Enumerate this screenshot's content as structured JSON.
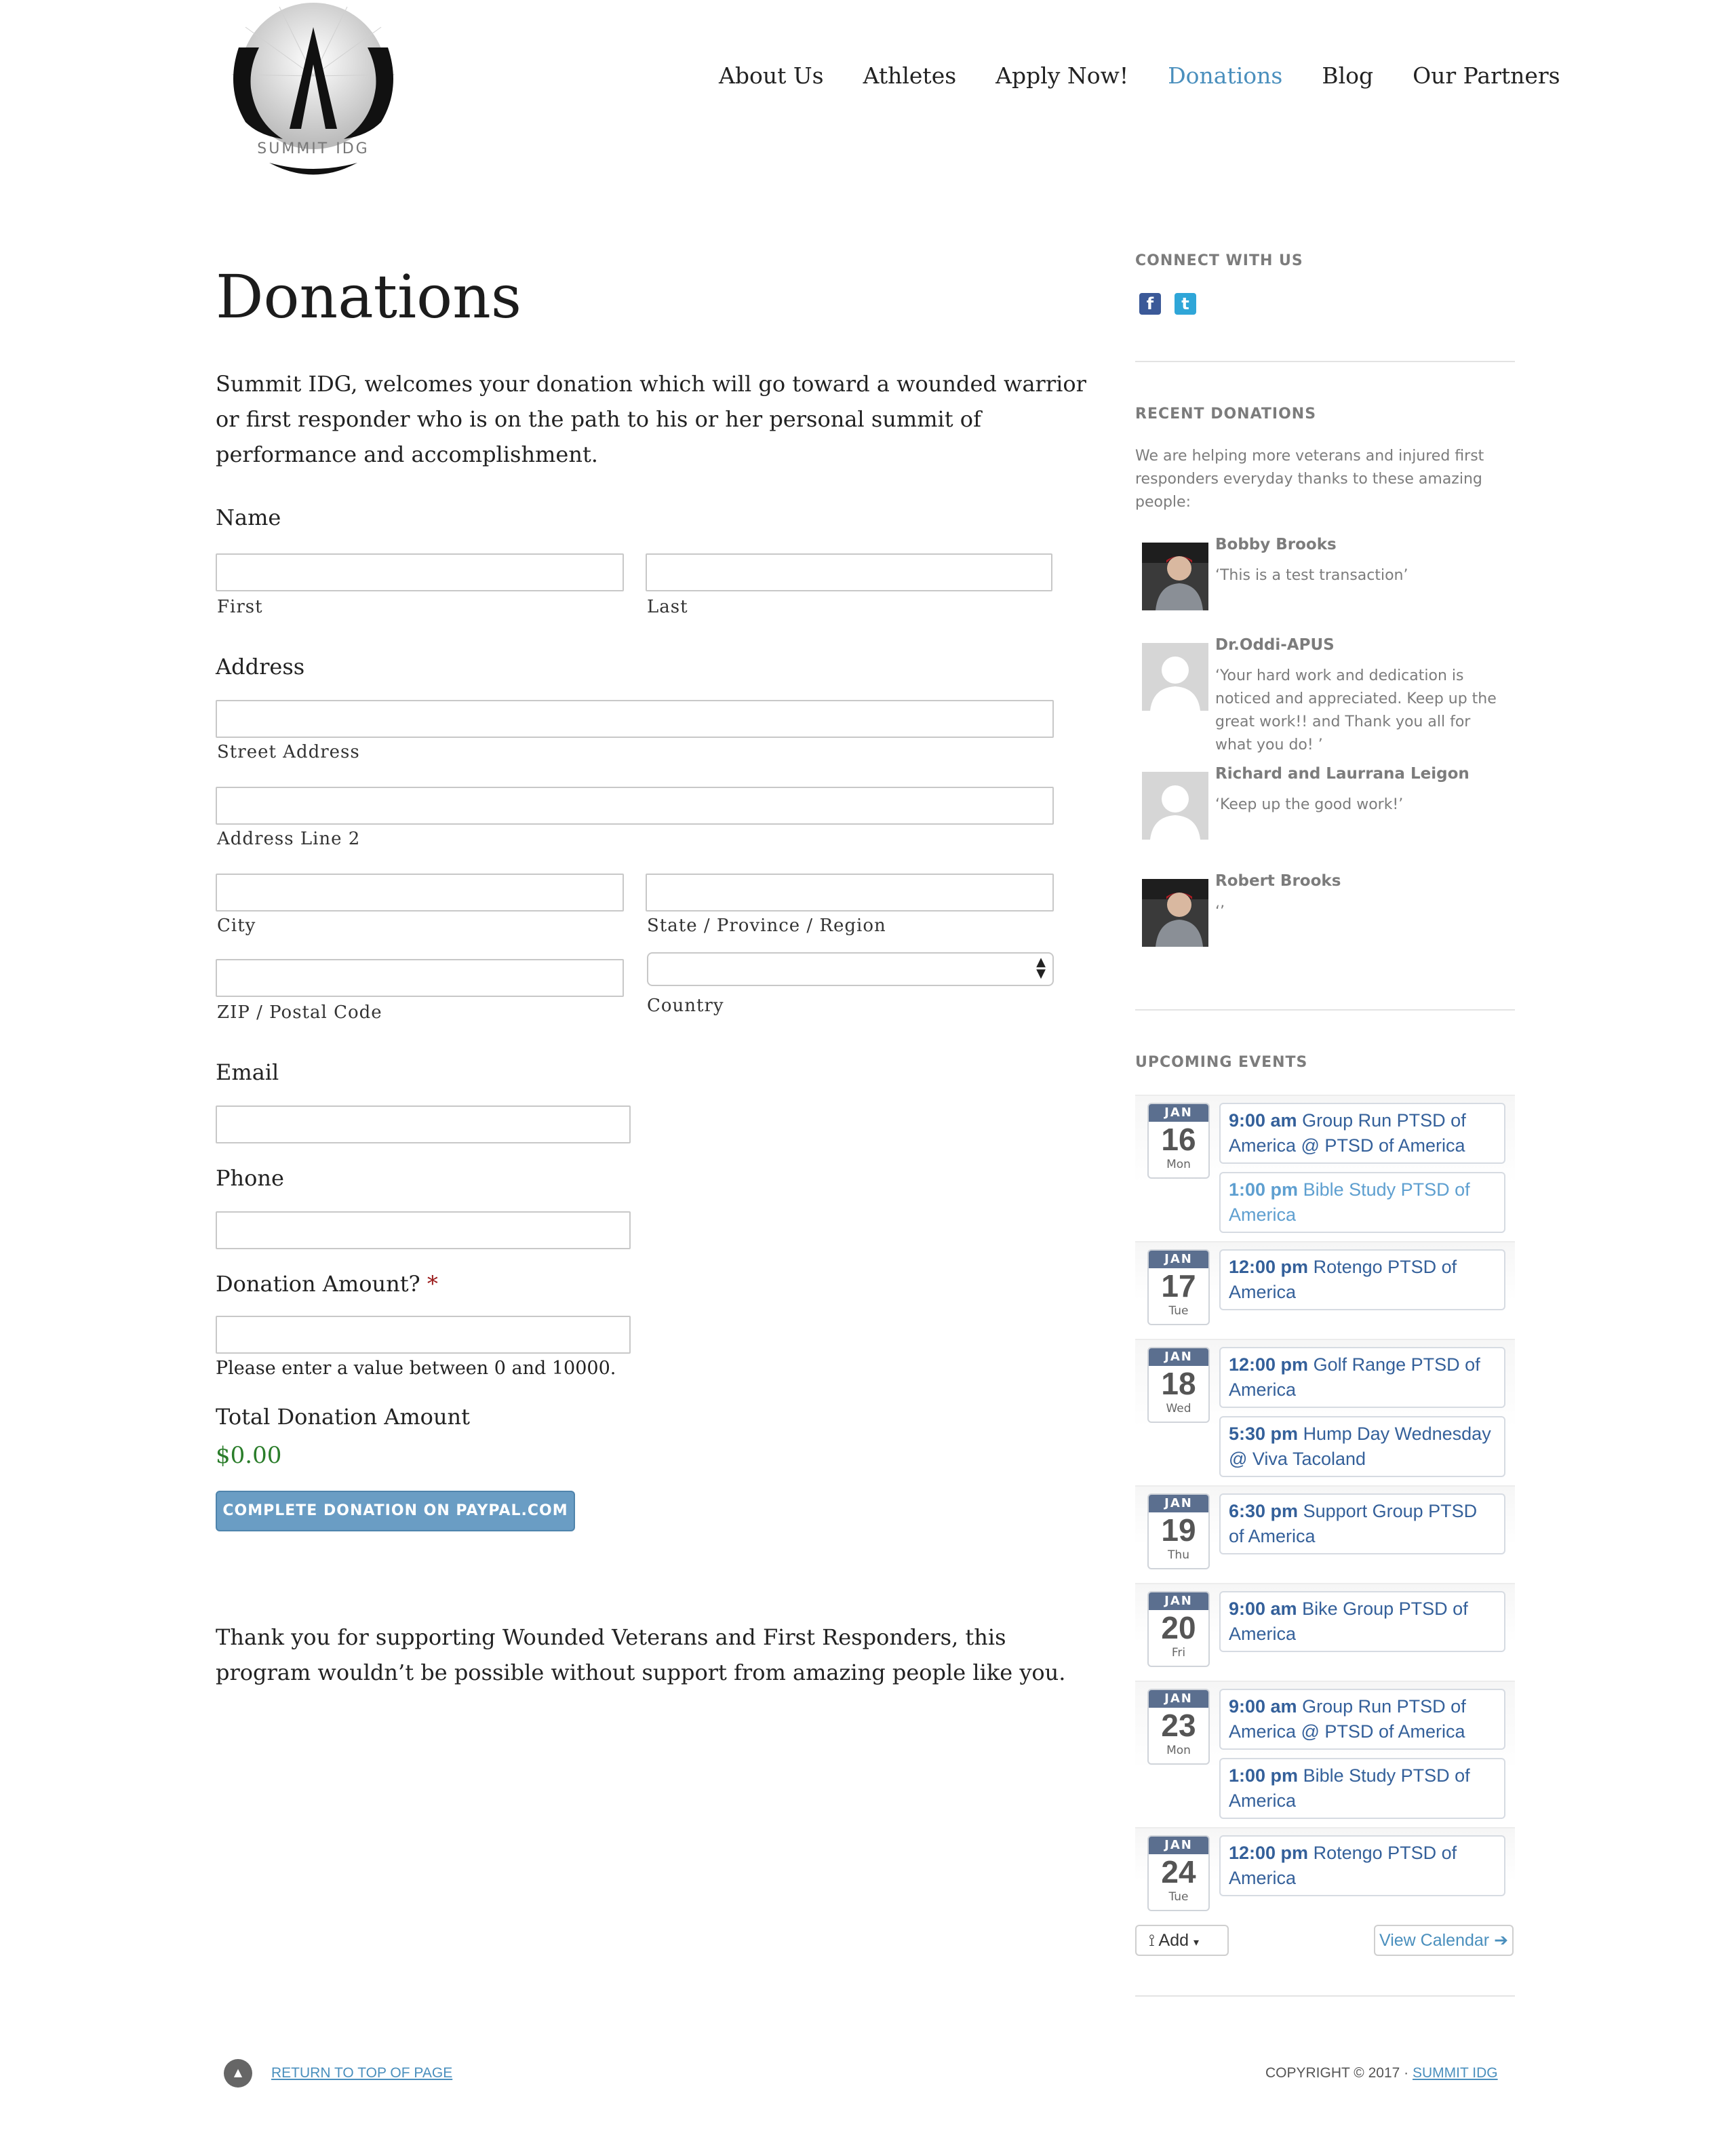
{
  "header": {
    "logo_text": "SUMMIT IDG",
    "nav": [
      {
        "label": "About Us",
        "active": false
      },
      {
        "label": "Athletes",
        "active": false
      },
      {
        "label": "Apply Now!",
        "active": false
      },
      {
        "label": "Donations",
        "active": true
      },
      {
        "label": "Blog",
        "active": false
      },
      {
        "label": "Our Partners",
        "active": false
      }
    ]
  },
  "main": {
    "title": "Donations",
    "intro": "Summit IDG, welcomes your donation which will go toward a wounded warrior or first responder who is on the path to his or her personal summit of performance and accomplishment.",
    "form": {
      "name_label": "Name",
      "first_label": "First",
      "last_label": "Last",
      "address_label": "Address",
      "street_label": "Street Address",
      "line2_label": "Address Line 2",
      "city_label": "City",
      "state_label": "State / Province / Region",
      "zip_label": "ZIP / Postal Code",
      "country_label": "Country",
      "email_label": "Email",
      "phone_label": "Phone",
      "amount_label": "Donation Amount?",
      "required_mark": "*",
      "amount_hint": "Please enter a value between 0 and 10000.",
      "total_label": "Total Donation Amount",
      "total_value": "$0.00",
      "submit_label": "COMPLETE DONATION ON PAYPAL.COM"
    },
    "thanks": "Thank you for supporting Wounded Veterans and First Responders, this program wouldn’t be possible without support from amazing people like you."
  },
  "sidebar": {
    "connect_title": "CONNECT WITH US",
    "social": [
      {
        "icon": "facebook-icon",
        "glyph": "f",
        "color": "#3b5998"
      },
      {
        "icon": "twitter-icon",
        "glyph": "t",
        "color": "#2fa6d8"
      }
    ],
    "recent_title": "RECENT DONATIONS",
    "recent_intro": "We are helping more veterans and injured first responders everyday thanks to these amazing people:",
    "donors": [
      {
        "name": "Bobby Brooks",
        "message": "‘This is a test transaction’",
        "avatar": "photo"
      },
      {
        "name": "Dr.Oddi-APUS",
        "message": "‘Your hard work and dedication is noticed and appreciated. Keep up the great work!! and Thank you all for what you do! ’",
        "avatar": "placeholder"
      },
      {
        "name": "Richard and Laurrana Leigon",
        "message": "‘Keep up the good work!’",
        "avatar": "placeholder"
      },
      {
        "name": "Robert Brooks",
        "message": "‘’",
        "avatar": "photo"
      }
    ],
    "events_title": "UPCOMING EVENTS",
    "event_days": [
      {
        "month": "JAN",
        "day": "16",
        "weekday": "Mon",
        "events": [
          {
            "time": "9:00 am",
            "title": "Group Run PTSD of America @ PTSD of America",
            "style": "dark"
          },
          {
            "time": "1:00 pm",
            "title": "Bible Study PTSD of America",
            "style": "light"
          }
        ]
      },
      {
        "month": "JAN",
        "day": "17",
        "weekday": "Tue",
        "events": [
          {
            "time": "12:00 pm",
            "title": "Rotengo PTSD of America",
            "style": "dark"
          }
        ]
      },
      {
        "month": "JAN",
        "day": "18",
        "weekday": "Wed",
        "events": [
          {
            "time": "12:00 pm",
            "title": "Golf Range PTSD of America",
            "style": "dark"
          },
          {
            "time": "5:30 pm",
            "title": "Hump Day Wednesday @ Viva Tacoland",
            "style": "dark"
          }
        ]
      },
      {
        "month": "JAN",
        "day": "19",
        "weekday": "Thu",
        "events": [
          {
            "time": "6:30 pm",
            "title": "Support Group PTSD of America",
            "style": "dark"
          }
        ]
      },
      {
        "month": "JAN",
        "day": "20",
        "weekday": "Fri",
        "events": [
          {
            "time": "9:00 am",
            "title": "Bike Group PTSD of America",
            "style": "dark"
          }
        ]
      },
      {
        "month": "JAN",
        "day": "23",
        "weekday": "Mon",
        "events": [
          {
            "time": "9:00 am",
            "title": "Group Run PTSD of America @ PTSD of America",
            "style": "dark"
          },
          {
            "time": "1:00 pm",
            "title": "Bible Study PTSD of America",
            "style": "dark"
          }
        ]
      },
      {
        "month": "JAN",
        "day": "24",
        "weekday": "Tue",
        "events": [
          {
            "time": "12:00 pm",
            "title": "Rotengo PTSD of America",
            "style": "dark"
          }
        ]
      }
    ],
    "add_label": "Add",
    "view_calendar_label": "View Calendar"
  },
  "footer": {
    "top_link": "RETURN TO TOP OF PAGE",
    "copyright": "COPYRIGHT © 2017 ·",
    "copyright_link": "SUMMIT IDG"
  }
}
